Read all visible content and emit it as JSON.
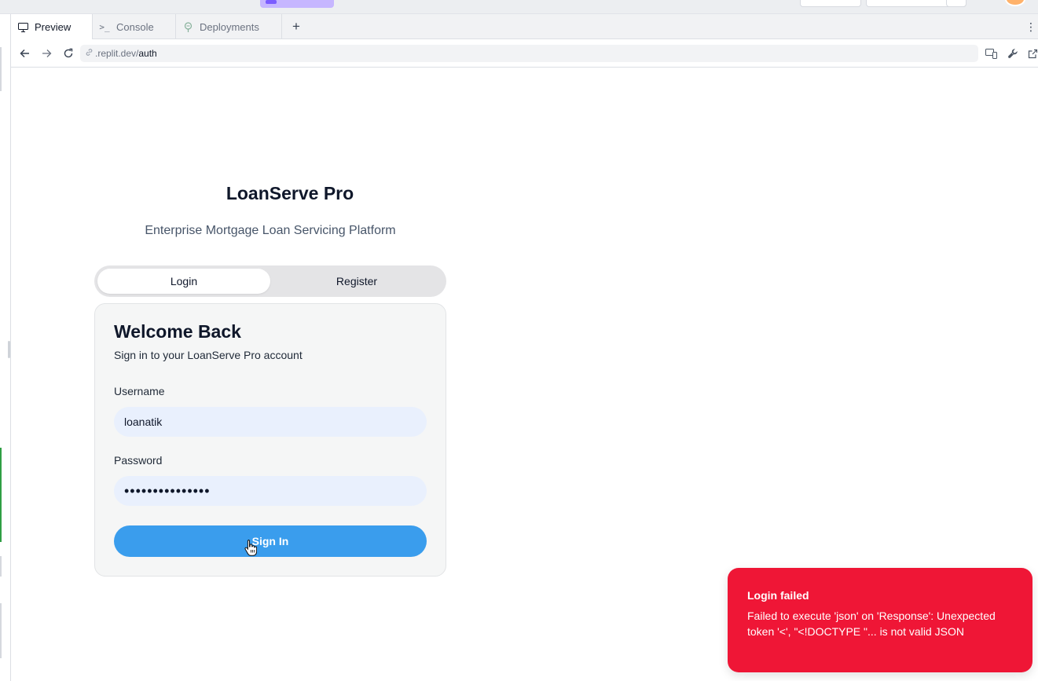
{
  "browser": {
    "tabs": [
      {
        "label": "Preview",
        "icon": "monitor-icon",
        "active": true
      },
      {
        "label": "Console",
        "icon": "terminal-icon",
        "active": false
      },
      {
        "label": "Deployments",
        "icon": "deploy-icon",
        "active": false
      }
    ],
    "add_tab_symbol": "+",
    "menu_symbol": "⋮",
    "url_prefix": ".replit.dev/",
    "url_path": "auth"
  },
  "app": {
    "title": "LoanServe Pro",
    "subtitle": "Enterprise Mortgage Loan Servicing Platform",
    "tabs": {
      "login": "Login",
      "register": "Register"
    },
    "card": {
      "title": "Welcome Back",
      "description": "Sign in to your LoanServe Pro account",
      "username_label": "Username",
      "username_value": "loanatik",
      "password_label": "Password",
      "password_value": "•••••••••••••••",
      "submit_label": "Sign In"
    }
  },
  "toast": {
    "title": "Login failed",
    "message": "Failed to execute 'json' on 'Response': Unexpected token '<', \"<!DOCTYPE \"... is not valid JSON"
  },
  "colors": {
    "primary": "#3a9ded",
    "toast_bg": "#ef1636",
    "input_bg": "#e9f0fd"
  }
}
